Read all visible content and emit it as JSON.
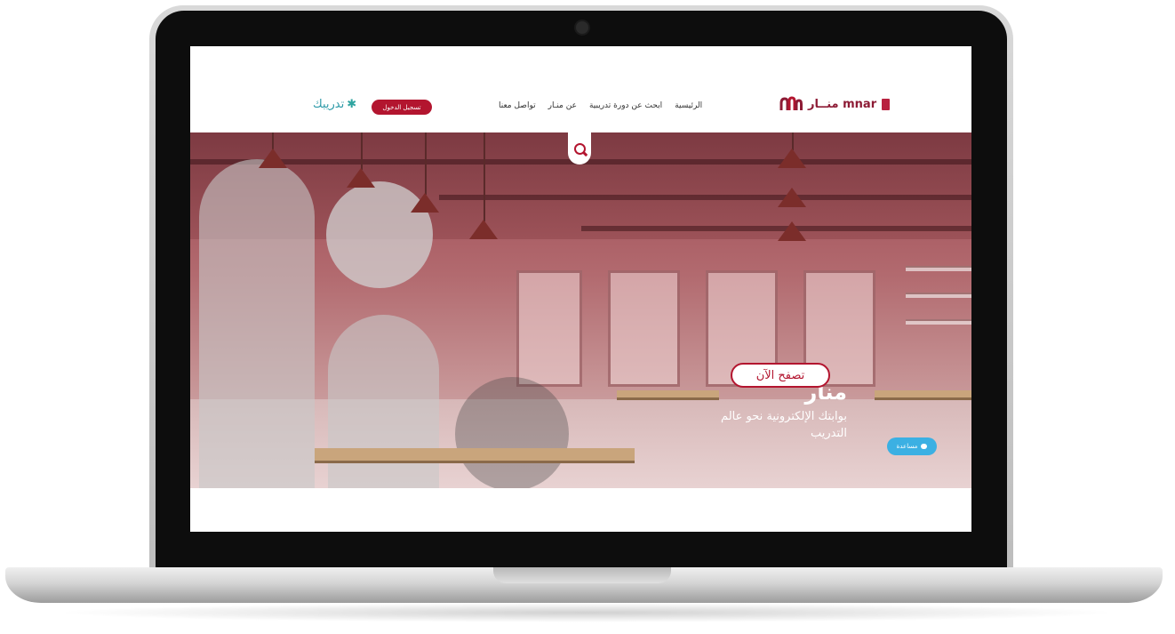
{
  "nav": {
    "brand_text": "منــار mnar",
    "menu": [
      "الرئيسية",
      "ابحث عن دورة تدريبية",
      "عن منـار",
      "تواصل معنا"
    ],
    "login_label": "تسجيل الدخول",
    "partner_text": "تدريبك"
  },
  "hero": {
    "title": "منار",
    "subtitle": "بوابتك الإلكترونية نحو عالم التدريب",
    "browse_label": "تصفح الآن"
  },
  "help": {
    "label": "مساعدة"
  },
  "colors": {
    "brand": "#b3152f",
    "partner": "#2d9aa8",
    "help": "#3bb0e3"
  },
  "icons": [
    "search-icon",
    "chat-icon",
    "star-icon",
    "mnar-logo-icon",
    "camera"
  ]
}
